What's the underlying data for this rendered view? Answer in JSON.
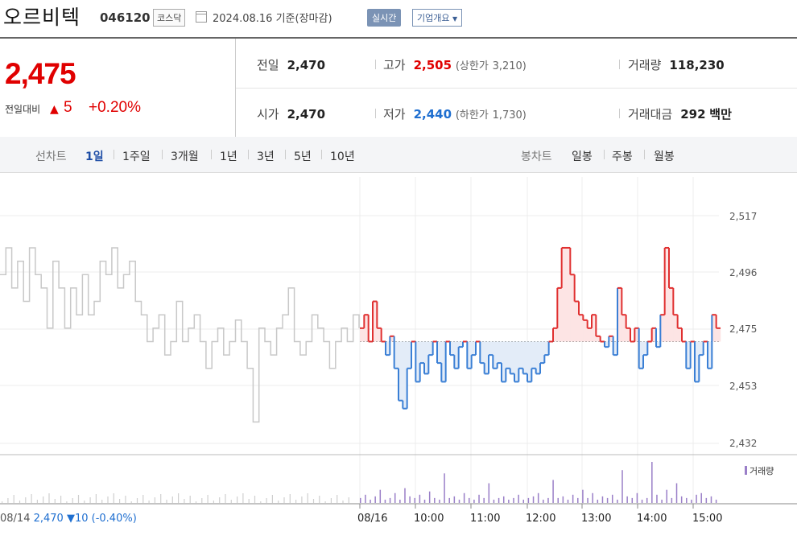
{
  "header": {
    "name": "오르비텍",
    "code": "046120",
    "market": "코스닥",
    "date": "2024.08.16",
    "basis": "기준(장마감)",
    "realtime": "실시간",
    "company": "기업개요"
  },
  "quote": {
    "price": "2,475",
    "change_label": "전일대비",
    "change_arrow": "▲",
    "change": "5",
    "change_pct": "+0.20%",
    "prev_label": "전일",
    "prev": "2,470",
    "high_label": "고가",
    "high": "2,505",
    "upper_label": "(상한가",
    "upper": "3,210)",
    "volume_label": "거래량",
    "volume": "118,230",
    "open_label": "시가",
    "open": "2,470",
    "low_label": "저가",
    "low": "2,440",
    "lower_label": "(하한가",
    "lower": "1,730)",
    "amount_label": "거래대금",
    "amount": "292",
    "amount_unit": "백만"
  },
  "tabs": {
    "line_label": "선차트",
    "line": [
      "1일",
      "1주일",
      "3개월",
      "1년",
      "3년",
      "5년",
      "10년"
    ],
    "selected": "1일",
    "candle_label": "봉차트",
    "candle": [
      "일봉",
      "주봉",
      "월봉"
    ]
  },
  "colors": {
    "up": "#e03030",
    "down": "#3a7fd5",
    "prev_day": "#c8c8c8",
    "volume": "#9a7fc8"
  },
  "chart_data": {
    "type": "line",
    "title": "",
    "x_labels": [
      "08/16",
      "10:00",
      "11:00",
      "12:00",
      "13:00",
      "14:00",
      "15:00"
    ],
    "prev_day_label": "08/14",
    "prev_close": 2470,
    "prev_close_text": "2,470",
    "prev_change_text": "▼10 (-0.40%)",
    "y_ticks": [
      "2,517",
      "2,496",
      "2,475",
      "2,453",
      "2,432"
    ],
    "ylim": [
      2432,
      2517
    ],
    "volume_legend": "거래량",
    "prev_series": [
      2495,
      2505,
      2490,
      2500,
      2485,
      2505,
      2495,
      2490,
      2475,
      2500,
      2490,
      2475,
      2490,
      2480,
      2495,
      2480,
      2485,
      2500,
      2495,
      2505,
      2490,
      2495,
      2500,
      2485,
      2480,
      2470,
      2475,
      2480,
      2465,
      2470,
      2485,
      2470,
      2475,
      2480,
      2470,
      2460,
      2470,
      2475,
      2465,
      2470,
      2478,
      2470,
      2460,
      2440,
      2475,
      2470,
      2465,
      2475,
      2480,
      2490,
      2470,
      2465,
      2470,
      2480,
      2475,
      2470,
      2460,
      2470,
      2475,
      2470,
      2480,
      2475
    ],
    "series": [
      {
        "name": "",
        "values": [
          2475,
          2480,
          2470,
          2485,
          2475,
          2470,
          2465,
          2472,
          2460,
          2448,
          2445,
          2460,
          2470,
          2455,
          2462,
          2458,
          2465,
          2470,
          2462,
          2455,
          2470,
          2465,
          2460,
          2468,
          2470,
          2460,
          2465,
          2470,
          2462,
          2458,
          2465,
          2460,
          2462,
          2455,
          2460,
          2458,
          2455,
          2460,
          2458,
          2455,
          2460,
          2458,
          2462,
          2465,
          2470,
          2475,
          2490,
          2505,
          2505,
          2495,
          2485,
          2480,
          2478,
          2475,
          2480,
          2472,
          2470,
          2468,
          2472,
          2465,
          2490,
          2480,
          2475,
          2470,
          2475,
          2460,
          2465,
          2470,
          2475,
          2468,
          2480,
          2505,
          2490,
          2480,
          2475,
          2470,
          2460,
          2470,
          2455,
          2465,
          2470,
          2460,
          2480,
          2475
        ]
      }
    ],
    "volumes": [
      3,
      5,
      2,
      4,
      8,
      2,
      3,
      6,
      2,
      9,
      4,
      3,
      5,
      2,
      7,
      3,
      2,
      18,
      3,
      4,
      2,
      6,
      3,
      2,
      5,
      3,
      12,
      2,
      3,
      4,
      2,
      3,
      5,
      2,
      3,
      4,
      6,
      2,
      3,
      14,
      3,
      4,
      2,
      5,
      3,
      8,
      3,
      6,
      2,
      4,
      3,
      5,
      2,
      20,
      4,
      3,
      6,
      2,
      3,
      25,
      5,
      2,
      8,
      3,
      12,
      4,
      3,
      2,
      5,
      6,
      3,
      4,
      2
    ]
  }
}
